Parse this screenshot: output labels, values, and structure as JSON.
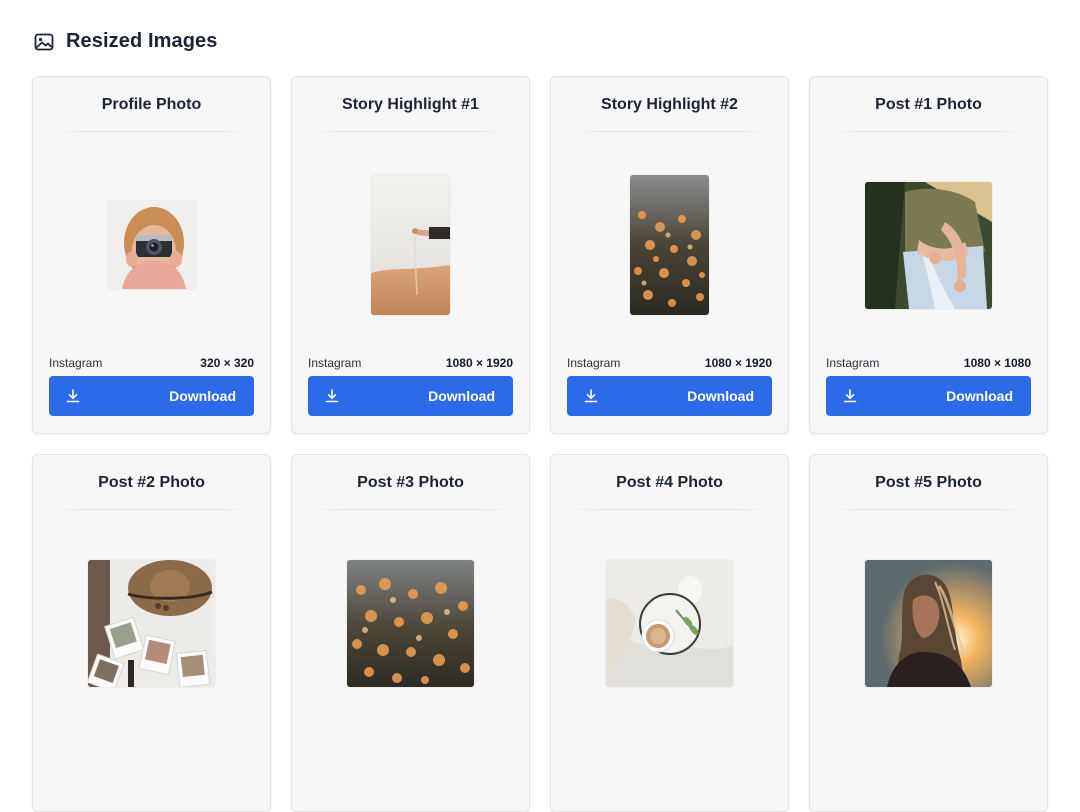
{
  "header": {
    "title": "Resized Images",
    "icon": "image-icon"
  },
  "cards": [
    {
      "title": "Profile Photo",
      "platform": "Instagram",
      "dims": "320 × 320",
      "button": "Download",
      "thumb": "profile-photo-thumbnail"
    },
    {
      "title": "Story Highlight #1",
      "platform": "Instagram",
      "dims": "1080 × 1920",
      "button": "Download",
      "thumb": "story-highlight-1-thumbnail"
    },
    {
      "title": "Story Highlight #2",
      "platform": "Instagram",
      "dims": "1080 × 1920",
      "button": "Download",
      "thumb": "story-highlight-2-thumbnail"
    },
    {
      "title": "Post #1 Photo",
      "platform": "Instagram",
      "dims": "1080 × 1080",
      "button": "Download",
      "thumb": "post-1-thumbnail"
    },
    {
      "title": "Post #2 Photo",
      "thumb": "post-2-thumbnail"
    },
    {
      "title": "Post #3 Photo",
      "thumb": "post-3-thumbnail"
    },
    {
      "title": "Post #4 Photo",
      "thumb": "post-4-thumbnail"
    },
    {
      "title": "Post #5 Photo",
      "thumb": "post-5-thumbnail"
    }
  ],
  "colors": {
    "accent": "#2b6bea",
    "card_bg": "#f7f7f7",
    "title": "#1c2433"
  }
}
